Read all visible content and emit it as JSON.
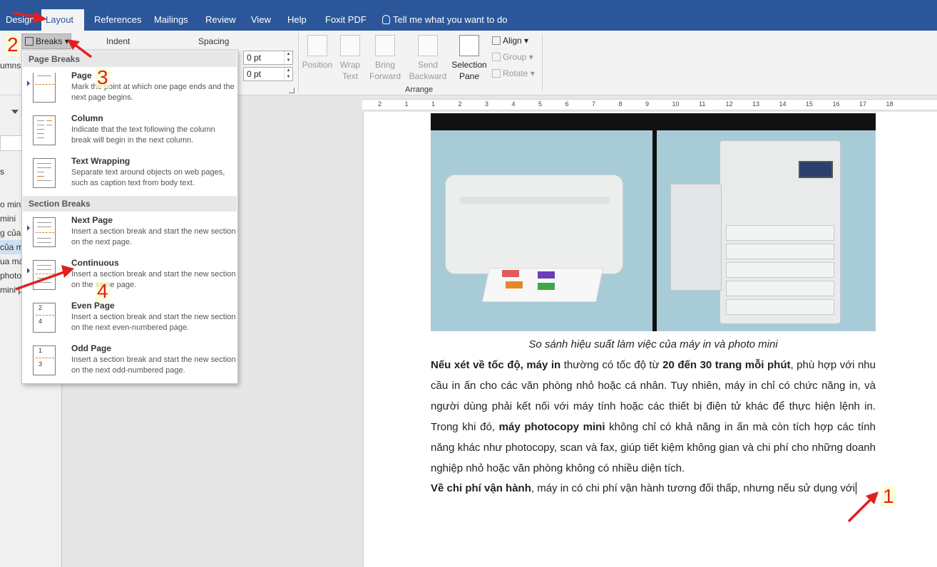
{
  "tabs": {
    "design": "Design",
    "layout": "Layout",
    "references": "References",
    "mailings": "Mailings",
    "review": "Review",
    "view": "View",
    "help": "Help",
    "foxit": "Foxit PDF",
    "tellme": "Tell me what you want to do"
  },
  "ribbon": {
    "columns_label": "umns",
    "breaks_label": "Breaks",
    "indent_label": "Indent",
    "spacing_label": "Spacing",
    "spacing_before": "0 pt",
    "spacing_after": "0 pt",
    "position": "Position",
    "wrap_text_1": "Wrap",
    "wrap_text_2": "Text",
    "bring_forward_1": "Bring",
    "bring_forward_2": "Forward",
    "send_backward_1": "Send",
    "send_backward_2": "Backward",
    "selection_pane_1": "Selection",
    "selection_pane_2": "Pane",
    "align": "Align",
    "group": "Group",
    "rotate": "Rotate",
    "arrange_group": "Arrange"
  },
  "ruler_ticks": [
    "2",
    "1",
    "1",
    "2",
    "3",
    "4",
    "5",
    "6",
    "7",
    "8",
    "9",
    "10",
    "11",
    "12",
    "13",
    "14",
    "15",
    "16",
    "17",
    "18"
  ],
  "nav": {
    "items": [
      "o min",
      "mini",
      "g của",
      "của m",
      "ua má",
      "photo",
      "mini p"
    ]
  },
  "breaks_menu": {
    "page_breaks_header": "Page Breaks",
    "section_breaks_header": "Section Breaks",
    "items": [
      {
        "title": "Page",
        "desc": "Mark the point at which one page ends and the next page begins."
      },
      {
        "title": "Column",
        "desc": "Indicate that the text following the column break will begin in the next column."
      },
      {
        "title": "Text Wrapping",
        "desc": "Separate text around objects on web pages, such as caption text from body text."
      },
      {
        "title": "Next Page",
        "desc": "Insert a section break and start the new section on the next page."
      },
      {
        "title": "Continuous",
        "desc": "Insert a section break and start the new section on the same page."
      },
      {
        "title": "Even Page",
        "desc": "Insert a section break and start the new section on the next even-numbered page."
      },
      {
        "title": "Odd Page",
        "desc": "Insert a section break and start the new section on the next odd-numbered page."
      }
    ],
    "even_icon_nums": [
      "2",
      "4"
    ],
    "odd_icon_nums": [
      "1",
      "3"
    ]
  },
  "document": {
    "figure_caption": "So sánh hiệu suất làm việc của máy in và photo mini",
    "p1_b1": "Nếu xét về tốc độ, máy in",
    "p1_t1": " thường có tốc độ từ ",
    "p1_b2": "20 đến 30 trang mỗi phút",
    "p1_t2": ", phù hợp với nhu cầu in ấn cho các văn phòng nhỏ hoặc cá nhân. Tuy nhiên, máy in chỉ có chức năng in, và người dùng phải kết nối với máy tính hoặc các thiết bị điện tử khác để thực hiện lệnh in. Trong khi đó, ",
    "p1_b3": "máy photocopy mini",
    "p1_t3": " không chỉ có khả năng in ấn mà còn tích hợp các tính năng khác như photocopy, scan và fax, giúp tiết kiệm không gian và chi phí cho những doanh nghiệp nhỏ hoặc văn phòng không có nhiều diện tích.",
    "p2_b1": "Về chi phí vận hành",
    "p2_t1": ", máy in có chi phí vận hành tương đối thấp, nhưng nếu sử dụng với"
  },
  "annotations": {
    "step1": "1",
    "step2": "2",
    "step3": "3",
    "step4": "4"
  },
  "colors": {
    "ribbon_blue": "#2b579a",
    "annotation_red": "#e02020"
  }
}
